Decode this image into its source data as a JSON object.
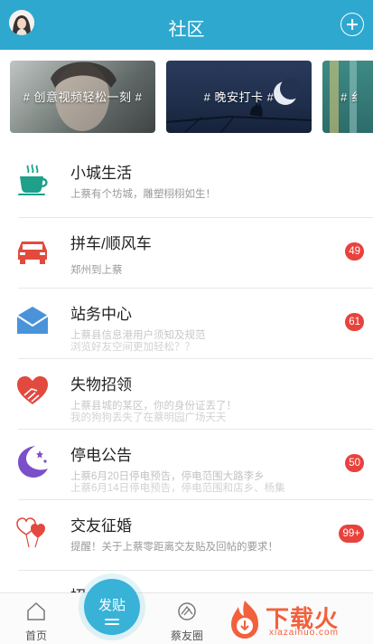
{
  "header": {
    "title": "社区"
  },
  "banners": [
    {
      "label": "# 创意视频轻松一刻 #"
    },
    {
      "label": "# 晚安打卡 #"
    },
    {
      "label": "# 纟"
    }
  ],
  "list": [
    {
      "name": "小城生活",
      "sub": "上蔡有个坊城，雕塑栩栩如生！",
      "sub2": "",
      "badge": ""
    },
    {
      "name": "拼车/顺风车",
      "sub": "郑州到上蔡",
      "sub2": "",
      "badge": "49"
    },
    {
      "name": "站务中心",
      "sub": "上蔡县信息港用户须知及规范",
      "sub2": "浏览好友空间更加轻松？？",
      "badge": "61"
    },
    {
      "name": "失物招领",
      "sub": "上蔡县城的某区，你的身份证丢了！",
      "sub2": "我的狗狗丢失了在蔡明园广场天天",
      "badge": ""
    },
    {
      "name": "停电公告",
      "sub": "上蔡6月20日停电预告，停电范围大路李乡",
      "sub2": "上蔡6月14日停电预告，停电范围和店乡、杨集",
      "badge": "50"
    },
    {
      "name": "交友征婚",
      "sub": "提醒！关于上蔡零距离交友贴及回帖的要求！",
      "sub2": "",
      "badge": "99+"
    },
    {
      "name": "招",
      "sub": "",
      "sub2": "",
      "badge": ""
    }
  ],
  "tabbar": {
    "home": "首页",
    "post": "发贴",
    "friends": "蔡友圈"
  },
  "watermark": {
    "text": "下载火",
    "url": "xiazaihuo.com"
  },
  "colors": {
    "header": "#2ea8cf",
    "badge": "#e8423d",
    "fab": "#39b2d7"
  }
}
